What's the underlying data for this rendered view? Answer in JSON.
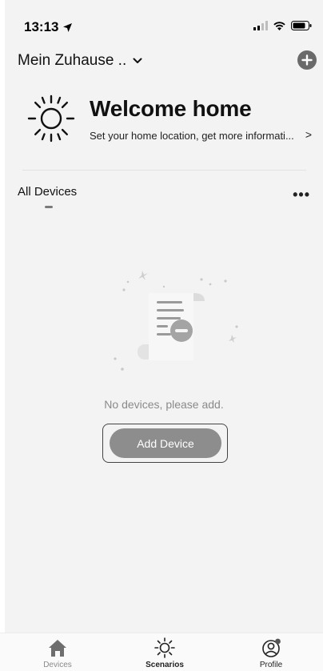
{
  "status_bar": {
    "time": "13:13"
  },
  "header": {
    "home_name": "Mein Zuhause .."
  },
  "welcome": {
    "title": "Welcome home",
    "subtitle": "Set your home location, get more informati...",
    "arrow": ">"
  },
  "tabs": {
    "all_devices": "All Devices",
    "more": "•••"
  },
  "empty_state": {
    "message": "No devices, please add.",
    "button_label": "Add Device"
  },
  "bottom_nav": {
    "items": [
      {
        "label": "Devices",
        "icon": "home-icon"
      },
      {
        "label": "Scenarios",
        "icon": "sun-icon"
      },
      {
        "label": "Profile",
        "icon": "profile-icon"
      }
    ]
  }
}
